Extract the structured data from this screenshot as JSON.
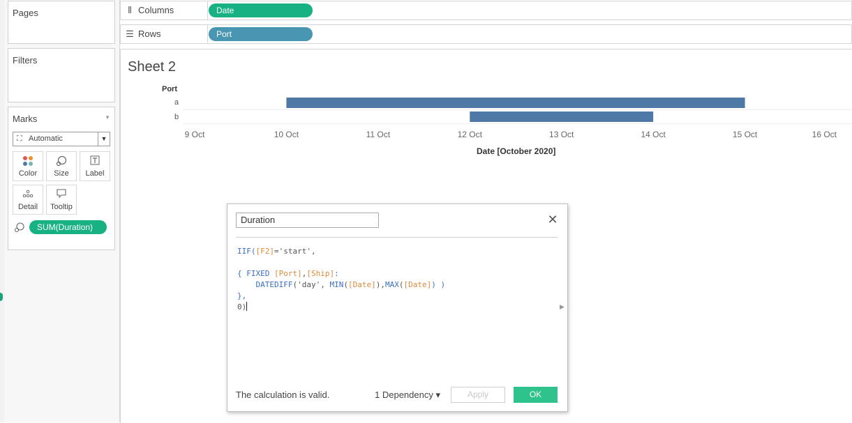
{
  "sidebar": {
    "pages_title": "Pages",
    "filters_title": "Filters",
    "marks": {
      "title": "Marks",
      "mark_type": "Automatic",
      "buttons": [
        "Color",
        "Size",
        "Label",
        "Detail",
        "Tooltip"
      ],
      "pill": "SUM(Duration)"
    }
  },
  "shelves": {
    "columns": {
      "label": "Columns",
      "pill": "Date"
    },
    "rows": {
      "label": "Rows",
      "pill": "Port"
    }
  },
  "view": {
    "sheet_title": "Sheet 2",
    "row_header": "Port"
  },
  "chart_data": {
    "type": "bar",
    "orientation": "horizontal-gantt",
    "categories": [
      "a",
      "b"
    ],
    "bars": [
      {
        "category": "a",
        "start": "2020-10-10",
        "end": "2020-10-15"
      },
      {
        "category": "b",
        "start": "2020-10-12",
        "end": "2020-10-14"
      }
    ],
    "x_ticks": [
      "9 Oct",
      "10 Oct",
      "11 Oct",
      "12 Oct",
      "13 Oct",
      "14 Oct",
      "15 Oct",
      "16 Oct"
    ],
    "xlim": [
      "2020-10-09",
      "2020-10-16"
    ],
    "xlabel": "Date [October 2020]",
    "ylabel": "Port",
    "bar_color": "#4e79a7"
  },
  "dialog": {
    "calc_name": "Duration",
    "formula": {
      "l1_fn": "IIF(",
      "l1_field": "[F2]",
      "l1_rest": "='start',",
      "l3_brace": "{ ",
      "l3_fixed": "FIXED",
      "l3_field1": "[Port]",
      "l3_comma": ",",
      "l3_field2": "[Ship]",
      "l3_colon": ":",
      "l4_fn": "DATEDIFF",
      "l4_arg": "('day', ",
      "l4_min": "MIN",
      "l4_paren1": "(",
      "l4_field1": "[Date]",
      "l4_close1": "),",
      "l4_max": "MAX",
      "l4_paren2": "(",
      "l4_field2": "[Date]",
      "l4_close2": ") )",
      "l5": "},",
      "l6": "0)"
    },
    "status_text": "The calculation is valid.",
    "dependency_label": "1 Dependency ▾",
    "apply_label": "Apply",
    "ok_label": "OK"
  },
  "colors": {
    "green_pill": "#18b183",
    "blue_pill": "#4996b2",
    "ok_button": "#2ec28c"
  }
}
